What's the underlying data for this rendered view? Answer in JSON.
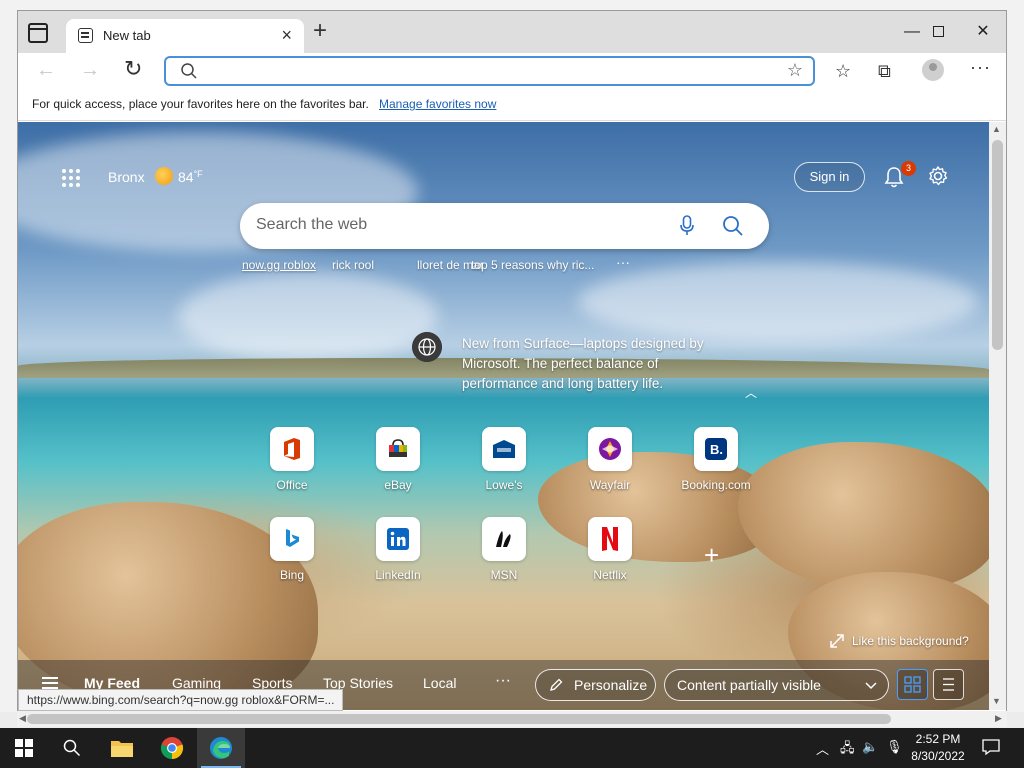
{
  "browser": {
    "tab_title": "New tab",
    "address_value": "",
    "favorites_bar_text": "For quick access, place your favorites here on the favorites bar.",
    "favorites_bar_link": "Manage favorites now",
    "status_url": "https://www.bing.com/search?q=now.gg roblox&FORM=..."
  },
  "newtab": {
    "location": "Bronx",
    "temperature": "84",
    "temp_unit": "°F",
    "sign_in": "Sign in",
    "notification_count": "3",
    "search_placeholder": "Search the web",
    "trending": [
      "now.gg roblox",
      "rick rool",
      "lloret de mar",
      "top 5 reasons why ric..."
    ],
    "promo": "New from Surface—laptops designed by Microsoft. The perfect balance of performance and long battery life.",
    "quick_links": [
      {
        "label": "Office",
        "icon": "office-icon"
      },
      {
        "label": "eBay",
        "icon": "ebay-icon"
      },
      {
        "label": "Lowe's",
        "icon": "lowes-icon"
      },
      {
        "label": "Wayfair",
        "icon": "wayfair-icon"
      },
      {
        "label": "Booking.com",
        "icon": "booking-icon"
      },
      {
        "label": "Bing",
        "icon": "bing-icon"
      },
      {
        "label": "LinkedIn",
        "icon": "linkedin-icon"
      },
      {
        "label": "MSN",
        "icon": "msn-icon"
      },
      {
        "label": "Netflix",
        "icon": "netflix-icon"
      }
    ],
    "like_background": "Like this background?",
    "feed_tabs": [
      "My Feed",
      "Gaming",
      "Sports",
      "Top Stories",
      "Local"
    ],
    "personalize": "Personalize",
    "content_visibility": "Content partially visible"
  },
  "taskbar": {
    "time": "2:52 PM",
    "date": "8/30/2022"
  },
  "colors": {
    "accent": "#0078d4",
    "badge": "#d83b01"
  }
}
